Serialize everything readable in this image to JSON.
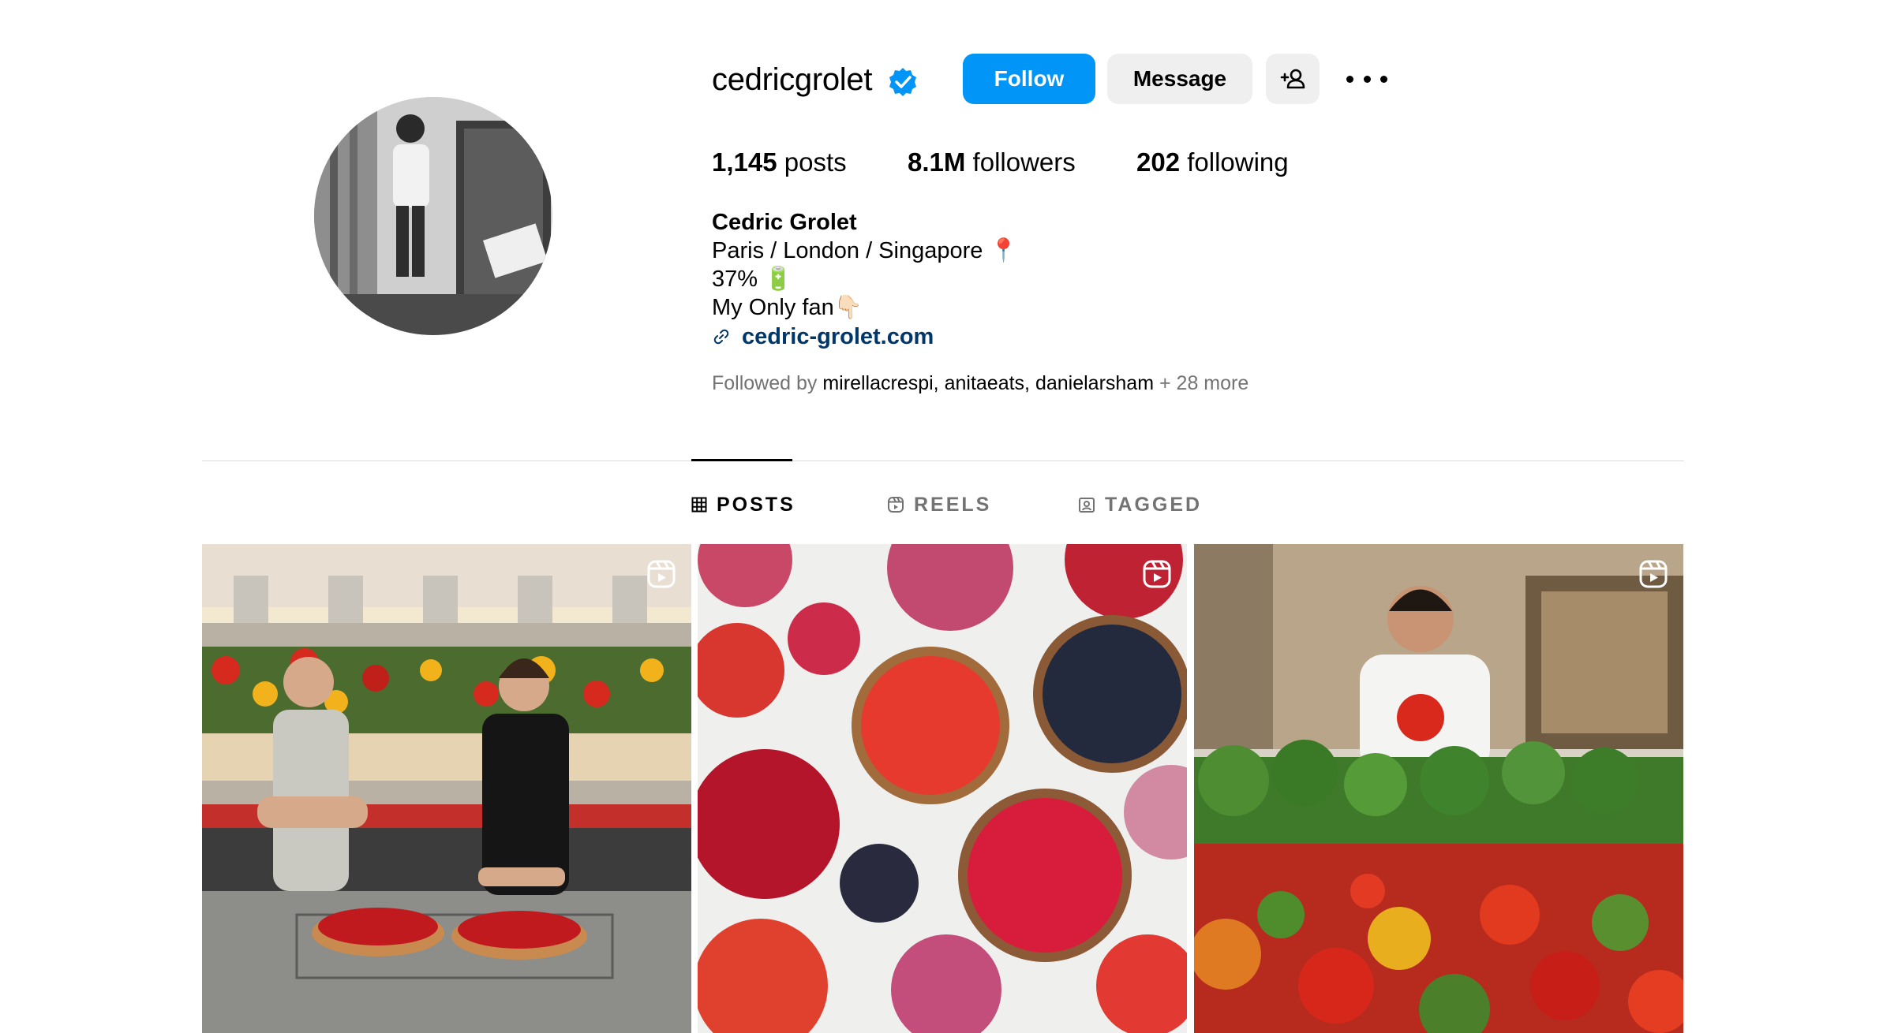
{
  "profile": {
    "username": "cedricgrolet",
    "verified_icon": "verified-badge-icon",
    "accent_color": "#0095f6",
    "buttons": {
      "follow": "Follow",
      "message": "Message",
      "add_user_icon": "add-person-icon",
      "more_icon": "more-options-icon"
    },
    "stats": {
      "posts_count": "1,145",
      "posts_label": "posts",
      "followers_count": "8.1M",
      "followers_label": "followers",
      "following_count": "202",
      "following_label": "following"
    },
    "bio": {
      "name": "Cedric Grolet",
      "line1": "Paris / London / Singapore 📍",
      "line2": "37% 🔋",
      "line3": "My Only fan👇🏻",
      "link_icon": "link-icon",
      "link": "cedric-grolet.com"
    },
    "followed_by": {
      "prefix": "Followed by",
      "user1": "mirellacrespi",
      "user2": "anitaeats",
      "user3": "danielarsham",
      "more": "+ 28 more"
    }
  },
  "tabs": {
    "posts": "POSTS",
    "reels": "REELS",
    "tagged": "TAGGED"
  },
  "grid": {
    "reel_icon": "reel-icon",
    "items": [
      {
        "type": "reel"
      },
      {
        "type": "reel"
      },
      {
        "type": "reel"
      }
    ]
  }
}
